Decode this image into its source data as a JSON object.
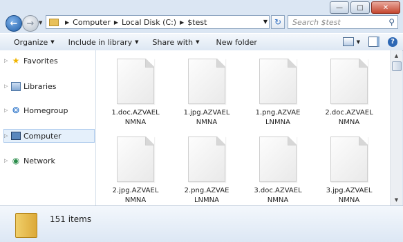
{
  "address": {
    "crumbs": [
      "Computer",
      "Local Disk (C:)",
      "$test"
    ]
  },
  "search": {
    "placeholder": "Search $test"
  },
  "commands": {
    "organize": "Organize",
    "include_in_library": "Include in library",
    "share_with": "Share with",
    "new_folder": "New folder"
  },
  "nav": {
    "items": [
      {
        "label": "Favorites",
        "icon": "star-icon"
      },
      {
        "label": "Libraries",
        "icon": "library-icon"
      },
      {
        "label": "Homegroup",
        "icon": "homegroup-icon"
      },
      {
        "label": "Computer",
        "icon": "computer-icon",
        "selected": true
      },
      {
        "label": "Network",
        "icon": "network-icon"
      }
    ]
  },
  "files": [
    {
      "name": "1.doc.AZVAELNMNA"
    },
    {
      "name": "1.jpg.AZVAELNMNA"
    },
    {
      "name": "1.png.AZVAELNMNA"
    },
    {
      "name": "2.doc.AZVAELNMNA"
    },
    {
      "name": "2.jpg.AZVAELNMNA"
    },
    {
      "name": "2.png.AZVAELNMNA"
    },
    {
      "name": "3.doc.AZVAELNMNA"
    },
    {
      "name": "3.jpg.AZVAELNMNA"
    }
  ],
  "details": {
    "item_count": "151 items"
  }
}
